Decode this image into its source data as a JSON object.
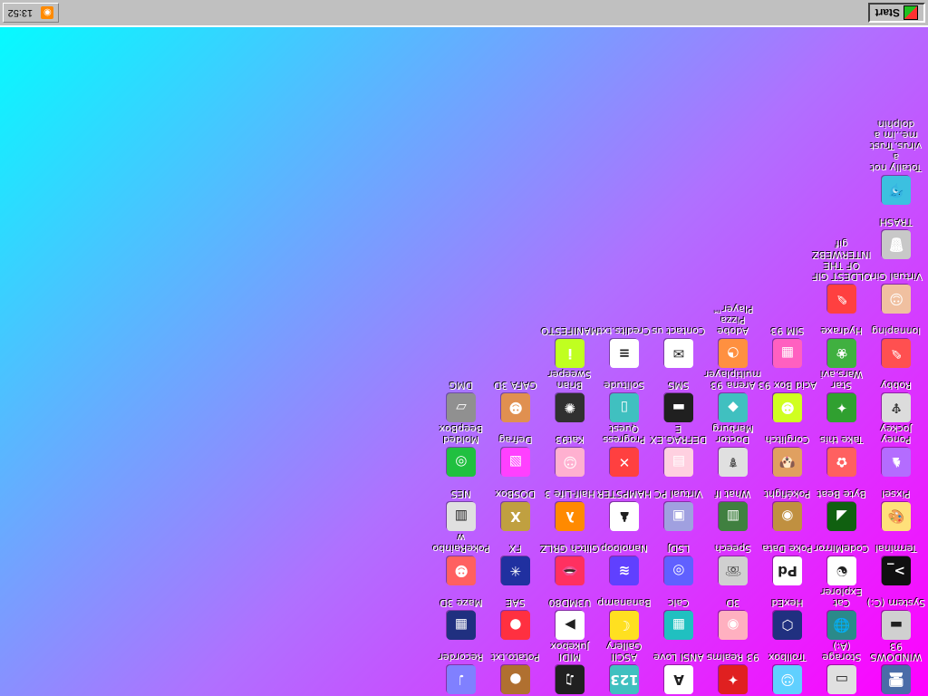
{
  "taskbar": {
    "start_label": "Start",
    "clock": "13:52",
    "tray_icon": "rss-icon"
  },
  "columns": [
    [
      {
        "name": "WINDOWS 93",
        "icon": "🖥",
        "color": "#4a6ca8"
      },
      {
        "name": "System (C:)",
        "icon": "▬",
        "color": "#d0d0d0"
      },
      {
        "name": "Terminal",
        "icon": ">_",
        "color": "#101010"
      },
      {
        "name": "Pixsel",
        "icon": "🎨",
        "color": "#ffe07a"
      },
      {
        "name": "Poney Jockey",
        "icon": "♞",
        "color": "#b46cff"
      },
      {
        "name": "Robby",
        "icon": "♆",
        "color": "#dcdcdc"
      },
      {
        "name": "lonnaping",
        "icon": "✎",
        "color": "#ff5050"
      },
      {
        "name": "Virtual Girl",
        "icon": "☺",
        "color": "#f0c0a0"
      },
      {
        "name": "TRASH",
        "icon": "🗑",
        "color": "#c8c8c8"
      },
      {
        "name": "Totally not a virus.Trust me..im a dolphin",
        "icon": "🐬",
        "color": "#3cc0e0"
      }
    ],
    [
      {
        "name": "Storage (A:)",
        "icon": "▭",
        "color": "#e0e0e0"
      },
      {
        "name": "Cat Explorer",
        "icon": "🌐",
        "color": "#2a8a8a"
      },
      {
        "name": "CodeMirror",
        "icon": "☯",
        "color": "#ffffff"
      },
      {
        "name": "Byte Beat",
        "icon": "◢",
        "color": "#106010"
      },
      {
        "name": "Take this",
        "icon": "✿",
        "color": "#ff6060"
      },
      {
        "name": "Star Wars.avi",
        "icon": "✦",
        "color": "#30a030"
      },
      {
        "name": "Hydraxe",
        "icon": "❀",
        "color": "#40b040"
      },
      {
        "name": "OLDEST GIF OF THE INTERWEBZ gif",
        "icon": "✎",
        "color": "#ff4040"
      }
    ],
    [
      {
        "name": "Trollbox",
        "icon": "☺",
        "color": "#60d0ff"
      },
      {
        "name": "HexEd",
        "icon": "⬡",
        "color": "#203080"
      },
      {
        "name": "Poke Data",
        "icon": "Pd",
        "color": "#ffffff"
      },
      {
        "name": "Pokéfight",
        "icon": "◉",
        "color": "#c09040"
      },
      {
        "name": "Corglitch",
        "icon": "🐶",
        "color": "#e0a060"
      },
      {
        "name": "Acid Box 93",
        "icon": "☻",
        "color": "#d0ff20"
      },
      {
        "name": "SIM 93",
        "icon": "▦",
        "color": "#ff60c0"
      }
    ],
    [
      {
        "name": "93 Realms",
        "icon": "✦",
        "color": "#e02020"
      },
      {
        "name": "3D",
        "icon": "◉",
        "color": "#ffb0c0"
      },
      {
        "name": "Speech",
        "icon": "☏",
        "color": "#d0d0d0"
      },
      {
        "name": "What If",
        "icon": "▥",
        "color": "#408040"
      },
      {
        "name": "Doctor Marburg",
        "icon": "☤",
        "color": "#e0e0e0"
      },
      {
        "name": "Arena 93 multiplayer",
        "icon": "◆",
        "color": "#40c0c0"
      },
      {
        "name": "Adobe Pizza Player™",
        "icon": "◔",
        "color": "#ff9040"
      }
    ],
    [
      {
        "name": "ANSI Love",
        "icon": "A",
        "color": "#ffffff"
      },
      {
        "name": "Calc",
        "icon": "▦",
        "color": "#20c0c0"
      },
      {
        "name": "LSDJ",
        "icon": "◎",
        "color": "#6060ff"
      },
      {
        "name": "Virtual PC",
        "icon": "▣",
        "color": "#a0a0e0"
      },
      {
        "name": "DEFRAG.EXE",
        "icon": "▤",
        "color": "#ffd0e0"
      },
      {
        "name": "SMS",
        "icon": "▬",
        "color": "#202020"
      },
      {
        "name": "Contact us",
        "icon": "✉",
        "color": "#ffffff"
      }
    ],
    [
      {
        "name": "ASCII Gallery",
        "icon": "123",
        "color": "#40c0c0"
      },
      {
        "name": "Bananamp",
        "icon": "☾",
        "color": "#ffe020"
      },
      {
        "name": "Nanoloop",
        "icon": "≋",
        "color": "#6040ff"
      },
      {
        "name": "HAMPSTER",
        "icon": "♟",
        "color": "#ffffff"
      },
      {
        "name": "Progress Quest",
        "icon": "✕",
        "color": "#ff4040"
      },
      {
        "name": "Solitude",
        "icon": "▯",
        "color": "#40c0c0"
      },
      {
        "name": "Credits.txt",
        "icon": "≡",
        "color": "#ffffff"
      }
    ],
    [
      {
        "name": "MIDI Jukebox",
        "icon": "♫",
        "color": "#202020"
      },
      {
        "name": "U3MD80",
        "icon": "▶",
        "color": "#ffffff"
      },
      {
        "name": "Glitch GRLZ",
        "icon": "👄",
        "color": "#ff3060"
      },
      {
        "name": "Half-Life 3",
        "icon": "λ",
        "color": "#ff8a00"
      },
      {
        "name": "Kat93",
        "icon": "☺",
        "color": "#ffb0d0"
      },
      {
        "name": "Brian Sweeper",
        "icon": "✺",
        "color": "#303030"
      },
      {
        "name": "MANIFESTO",
        "icon": "i",
        "color": "#c0ff20"
      }
    ],
    [
      {
        "name": "Potato.txt",
        "icon": "●",
        "color": "#b07030"
      },
      {
        "name": "SAE",
        "icon": "●",
        "color": "#ff3040"
      },
      {
        "name": "FX",
        "icon": "✳",
        "color": "#2030a0"
      },
      {
        "name": "DOSBox",
        "icon": "X",
        "color": "#c0a040"
      },
      {
        "name": "Defrag",
        "icon": "▧",
        "color": "#ff40ff"
      },
      {
        "name": "GAFA 3D",
        "icon": "☻",
        "color": "#e09050"
      }
    ],
    [
      {
        "name": "Recorder",
        "icon": "♩",
        "color": "#8080ff"
      },
      {
        "name": "Maze 3D",
        "icon": "▦",
        "color": "#203080"
      },
      {
        "name": "PokeRainbow",
        "icon": "☻",
        "color": "#ff6060"
      },
      {
        "name": "NES",
        "icon": "▥",
        "color": "#e0e0e0"
      },
      {
        "name": "Molded BeepBox",
        "icon": "◎",
        "color": "#20c040"
      },
      {
        "name": "DMG",
        "icon": "▱",
        "color": "#909090"
      }
    ]
  ]
}
